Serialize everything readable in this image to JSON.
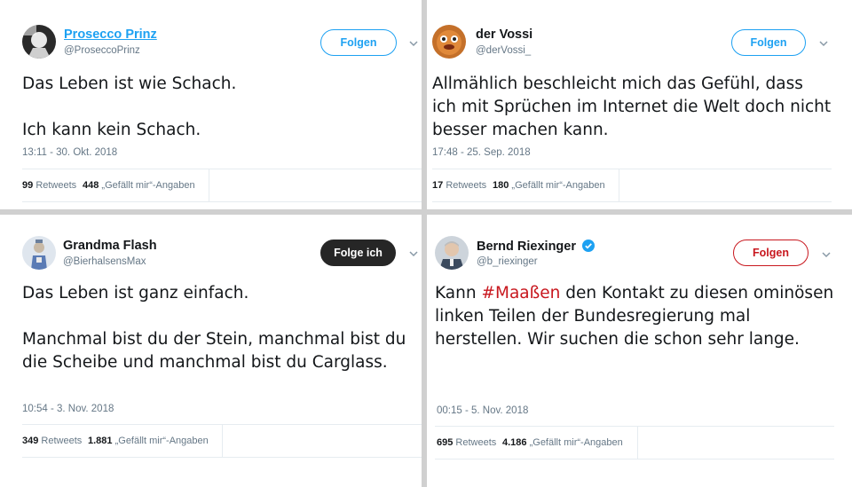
{
  "tweets": [
    {
      "name": "Prosecco Prinz",
      "handle": "@ProseccoPrinz",
      "button": "Folgen",
      "text": "Das Leben ist wie Schach.\n\nIch kann kein Schach.",
      "time": "13:11 - 30. Okt. 2018",
      "retweets": "99",
      "retweets_label": "Retweets",
      "likes": "448",
      "likes_label": "„Gefällt mir“-Angaben"
    },
    {
      "name": "der Vossi",
      "handle": "@derVossi_",
      "button": "Folgen",
      "text": "Allmählich beschleicht mich das Gefühl, dass ich mit Sprüchen im Internet die Welt doch nicht besser machen kann.",
      "time": "17:48 - 25. Sep. 2018",
      "retweets": "17",
      "retweets_label": "Retweets",
      "likes": "180",
      "likes_label": "„Gefällt mir“-Angaben"
    },
    {
      "name": "Grandma Flash",
      "handle": "@BierhalsensMax",
      "button": "Folge ich",
      "text": "Das Leben ist ganz einfach.\n\nManchmal bist du der Stein, manchmal bist du die Scheibe und manchmal bist du Carglass.",
      "time": "10:54 - 3. Nov. 2018",
      "retweets": "349",
      "retweets_label": "Retweets",
      "likes": "1.881",
      "likes_label": "„Gefällt mir“-Angaben"
    },
    {
      "name": "Bernd Riexinger",
      "handle": "@b_riexinger",
      "button": "Folgen",
      "text_before": "Kann ",
      "hashtag": "#Maaßen",
      "text_after": " den Kontakt zu diesen ominösen linken Teilen der Bundesregierung mal herstellen. Wir suchen die schon sehr lange.",
      "time": "00:15 - 5. Nov. 2018",
      "retweets": "695",
      "retweets_label": "Retweets",
      "likes": "4.186",
      "likes_label": "„Gefällt mir“-Angaben"
    }
  ],
  "colors": {
    "twitter_blue": "#1da1f2",
    "party_red": "#c8171e",
    "following_dark": "#262626",
    "verified": "#1da1f2"
  },
  "icons": [
    "avatar-image",
    "chevron-down-icon",
    "verified-badge-icon"
  ]
}
